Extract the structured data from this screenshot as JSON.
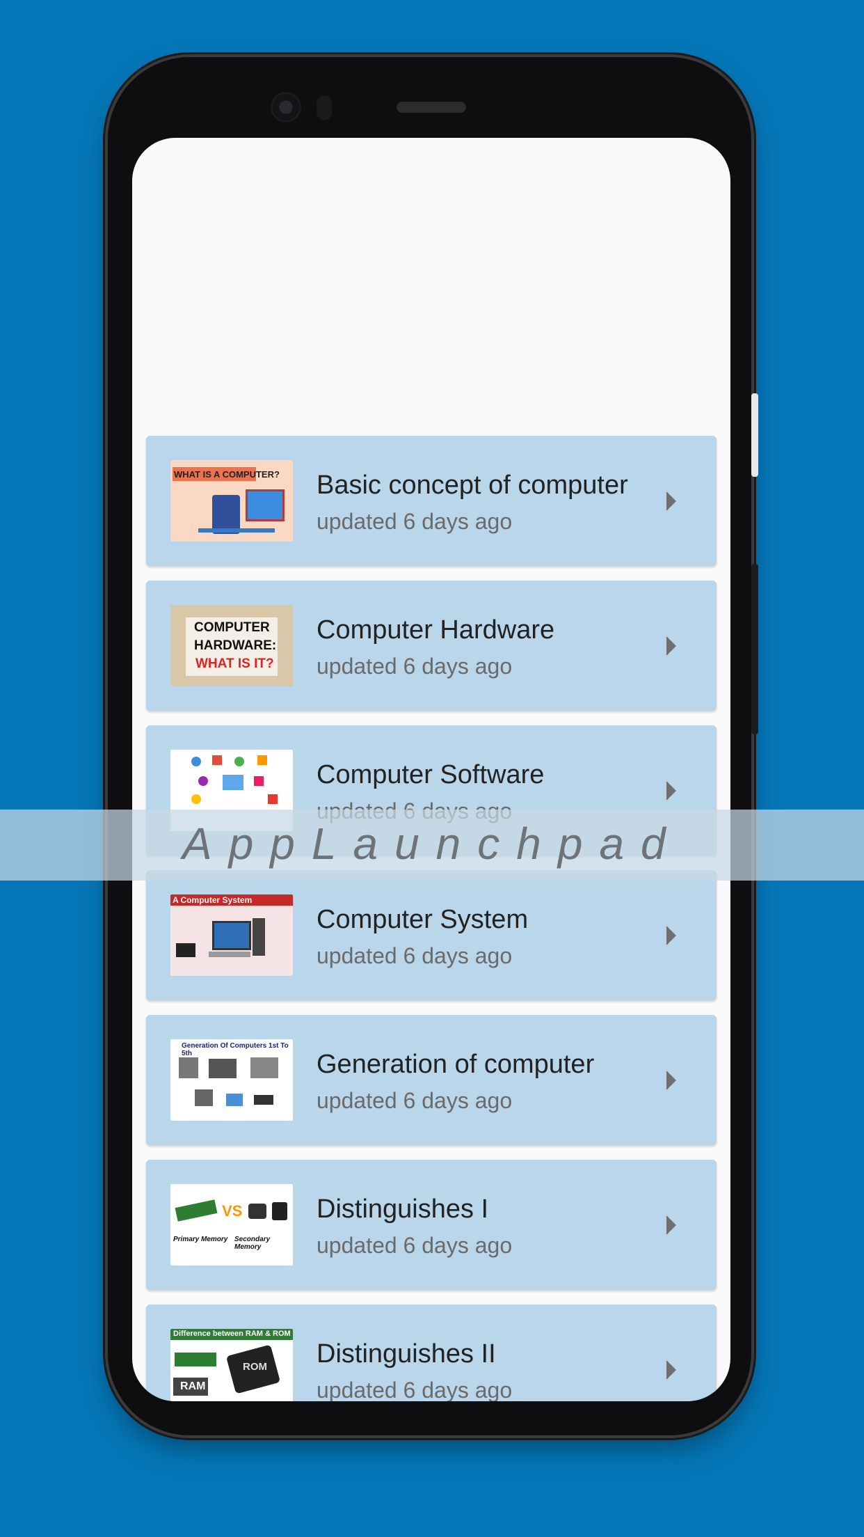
{
  "watermark": "AppLaunchpad",
  "items": [
    {
      "title": "Basic concept of computer",
      "subtitle": "updated 6 days ago",
      "thumb": {
        "line1": "WHAT IS A COMPUTER?"
      }
    },
    {
      "title": "Computer Hardware",
      "subtitle": "updated 6 days ago",
      "thumb": {
        "line1": "COMPUTER",
        "line2": "HARDWARE:",
        "line3": "WHAT IS IT?"
      }
    },
    {
      "title": "Computer Software",
      "subtitle": "updated 6 days ago",
      "thumb": {}
    },
    {
      "title": "Computer System",
      "subtitle": "updated 6 days ago",
      "thumb": {
        "line1": "A Computer System"
      }
    },
    {
      "title": "Generation of computer",
      "subtitle": "updated 6 days ago",
      "thumb": {
        "line1": "Generation Of Computers 1st To 5th"
      }
    },
    {
      "title": "Distinguishes I",
      "subtitle": "updated 6 days ago",
      "thumb": {
        "line1": "VS",
        "line2": "Primary Memory",
        "line3": "Secondary Memory"
      }
    },
    {
      "title": "Distinguishes II",
      "subtitle": "updated 6 days ago",
      "thumb": {
        "line1": "Difference between RAM & ROM",
        "line2": "RAM",
        "line3": "ROM"
      }
    }
  ]
}
